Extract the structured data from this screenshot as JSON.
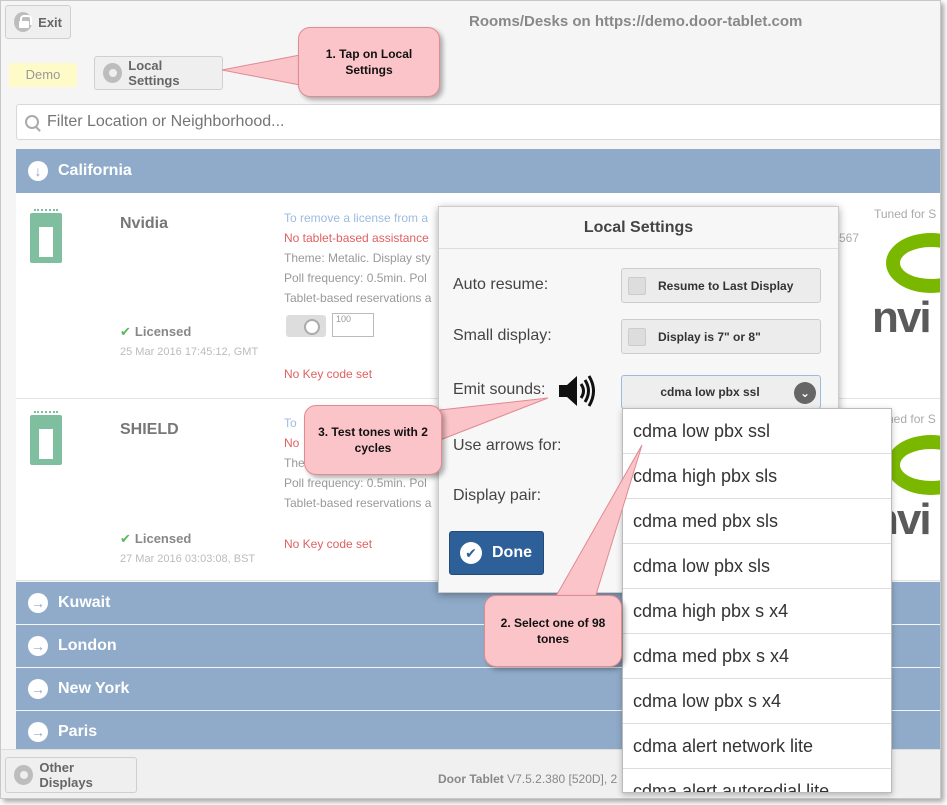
{
  "header": {
    "exit_label": "Exit",
    "title": "Rooms/Desks on https://demo.door-tablet.com",
    "demo_badge": "Demo",
    "local_settings_label": "Local Settings"
  },
  "filter": {
    "placeholder": "Filter Location or Neighborhood..."
  },
  "regions": {
    "california": {
      "name": "California"
    },
    "kuwait": {
      "name": "Kuwait"
    },
    "london": {
      "name": "London"
    },
    "new_york": {
      "name": "New York"
    },
    "paris": {
      "name": "Paris"
    }
  },
  "rooms": [
    {
      "name": "Nvidia",
      "status": "Licensed",
      "timestamp": "25 Mar 2016 17:45:12, GMT",
      "line1": "To remove a license from a",
      "line2": "No tablet-based assistance",
      "line3": "Theme: Metalic. Display sty",
      "line4": "Poll frequency: 0.5min. Pol",
      "line5": "Tablet-based reservations a",
      "keycode": "No Key code set",
      "tuned": "Tuned for S",
      "partial_number": "567",
      "poll_icon_text": "100"
    },
    {
      "name": "SHIELD",
      "status": "Licensed",
      "timestamp": "27 Mar 2016 03:03:08, BST",
      "line1": "To",
      "line2": "No",
      "line3": "The",
      "line4": "Poll frequency: 0.5min. Pol",
      "line5": "Tablet-based reservations a",
      "keycode": "No Key code set",
      "tuned": "ned for S"
    }
  ],
  "logo_text": "nvi",
  "footer": {
    "other_displays_label": "Other Displays",
    "brand": "Door Tablet",
    "version": "V7.5.2.380 [520D], 2"
  },
  "modal": {
    "title": "Local Settings",
    "auto_resume_label": "Auto resume:",
    "auto_resume_value": "Resume to Last Display",
    "small_display_label": "Small display:",
    "small_display_value": "Display is 7\" or 8\"",
    "emit_sounds_label": "Emit sounds:",
    "emit_sounds_value": "cdma low pbx ssl",
    "use_arrows_label": "Use arrows for:",
    "display_pair_label": "Display pair:",
    "done_label": "Done"
  },
  "dropdown_options": [
    "cdma low pbx ssl",
    "cdma high pbx sls",
    "cdma med pbx sls",
    "cdma low pbx sls",
    "cdma high pbx s x4",
    "cdma med pbx s x4",
    "cdma low pbx s x4",
    "cdma alert network lite",
    "cdma alert autoredial lite"
  ],
  "callouts": {
    "one": "1. Tap on Local Settings",
    "two": "2. Select one of 98 tones",
    "three": "3. Test tones with 2 cycles"
  },
  "colors": {
    "region_bar": "#8fabc9",
    "callout_fill": "#fbc4c8",
    "done_button": "#2d5f99",
    "licensed_check": "#5cb85c",
    "error_text": "#e06060"
  }
}
